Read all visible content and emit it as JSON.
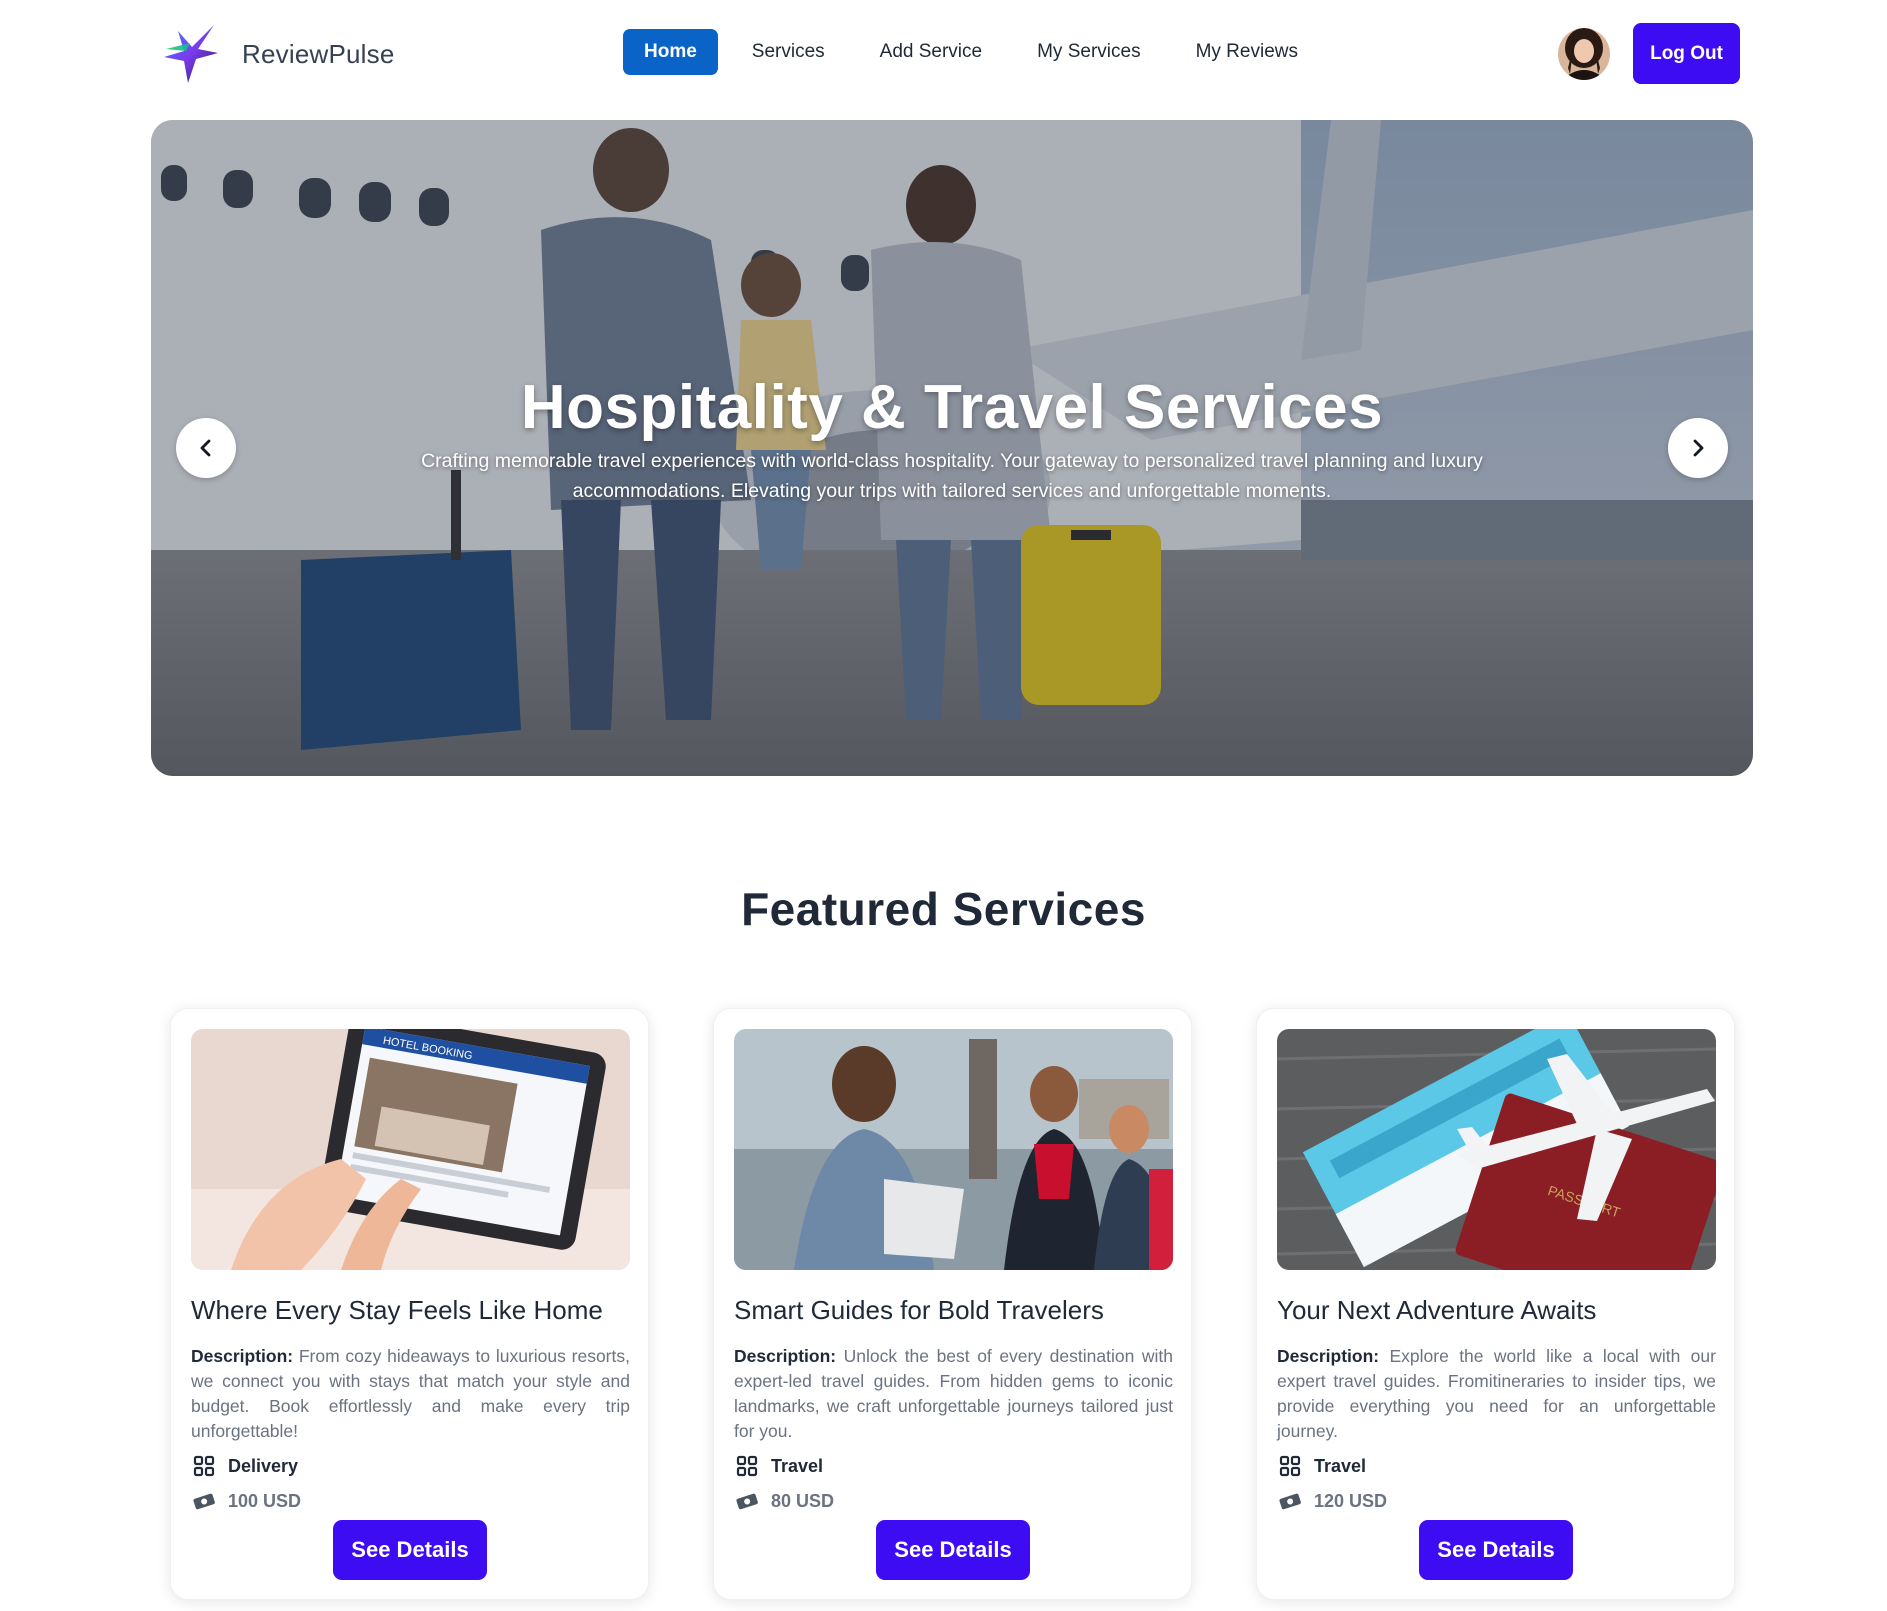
{
  "brand": {
    "name": "ReviewPulse",
    "logo": "star-logo-icon"
  },
  "nav": {
    "links": [
      "Home",
      "Services",
      "Add Service",
      "My Services",
      "My Reviews"
    ],
    "active": "Home"
  },
  "user": {
    "avatar": "user-avatar",
    "logout_label": "Log Out"
  },
  "hero": {
    "title": "Hospitality & Travel Services",
    "description": "Crafting memorable travel experiences with world-class hospitality. Your gateway to personalized travel planning and luxury accommodations. Elevating your trips with tailored services and unforgettable moments.",
    "prev_icon": "chevron-left-icon",
    "next_icon": "chevron-right-icon"
  },
  "featured": {
    "title": "Featured Services",
    "description_label": "Description:",
    "button_label": "See Details",
    "cards": [
      {
        "title": "Where Every Stay Feels Like Home",
        "description": "From cozy hideaways to luxurious resorts, we connect you with stays that match your style and budget. Book effortlessly and make every trip unforgettable!",
        "category": "Delivery",
        "price": "100 USD",
        "image_text": "HOTEL BOOKING"
      },
      {
        "title": "Smart Guides for Bold Travelers",
        "description": "Unlock the best of every destination with expert-led travel guides. From hidden gems to iconic landmarks, we craft unforgettable journeys tailored just for you.",
        "category": "Travel",
        "price": "80 USD"
      },
      {
        "title": "Your Next Adventure Awaits",
        "description": "Explore the world like a local with our expert travel guides. Fromitineraries to insider tips, we provide everything you need for an unforgettable journey.",
        "category": "Travel",
        "price": "120 USD",
        "image_text": "PASSPORT"
      }
    ]
  },
  "colors": {
    "primary": "#3d0cf2",
    "nav_active": "#0a63c7",
    "text": "#1f2937",
    "muted": "#6b7280"
  }
}
